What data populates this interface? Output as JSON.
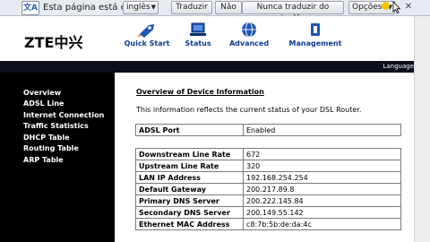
{
  "translate_bar": {
    "prompt": "Esta página está em",
    "language": "inglês",
    "translate_button": "Traduzir",
    "no_button": "Não",
    "never_button": "Nunca traduzir do inglês",
    "options_button": "Opções",
    "icon": "translate-icon"
  },
  "header": {
    "logo": "ZTE中兴",
    "nav": [
      {
        "label": "Quick Start",
        "icon": "rocket-icon"
      },
      {
        "label": "Status",
        "icon": "computer-icon"
      },
      {
        "label": "Advanced",
        "icon": "globe-icon"
      },
      {
        "label": "Management",
        "icon": "wrench-icon"
      }
    ],
    "language_link": "Language"
  },
  "sidebar": {
    "items": [
      "Overview",
      "ADSL Line",
      "Internet Connection",
      "Traffic Statistics",
      "DHCP Table",
      "Routing Table",
      "ARP Table"
    ]
  },
  "main": {
    "title": "Overview of Device Information",
    "description": "This information reflects the current status of your DSL Router.",
    "adsl": {
      "label": "ADSL Port",
      "value": "Enabled"
    },
    "rows": [
      {
        "label": "Downstream Line Rate",
        "value": "672"
      },
      {
        "label": "Upstream Line Rate",
        "value": "320"
      },
      {
        "label": "LAN IP Address",
        "value": "192.168.254.254"
      },
      {
        "label": "Default Gateway",
        "value": "200.217.89.8"
      },
      {
        "label": "Primary DNS Server",
        "value": "200.222.145.84"
      },
      {
        "label": "Secondary DNS Server",
        "value": "200.149.55.142"
      },
      {
        "label": "Ethernet MAC Address",
        "value": "c8:7b:5b:de:da:4c"
      }
    ]
  },
  "colors": {
    "nav_text": "#0b3d8c",
    "sidebar_bg": "#000000",
    "header_bar": "#0c0f1a"
  }
}
